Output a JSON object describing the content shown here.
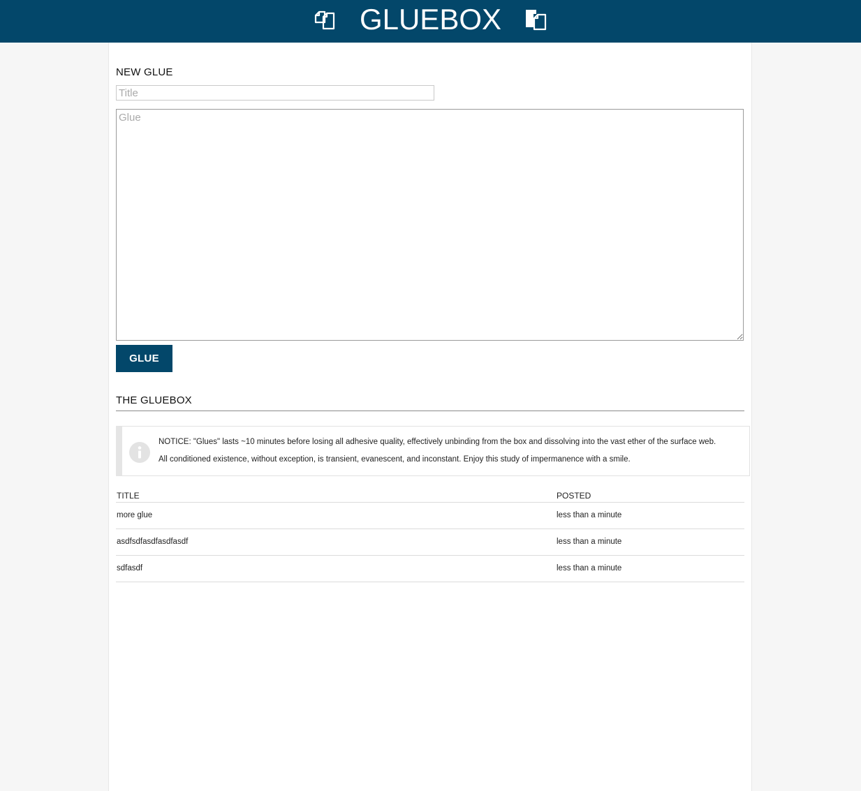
{
  "header": {
    "brand": "GLUEBOX",
    "left_icon": "copy-icon",
    "right_icon": "paste-icon"
  },
  "new_glue": {
    "heading": "NEW GLUE",
    "title_placeholder": "Title",
    "glue_placeholder": "Glue",
    "button_label": "GLUE"
  },
  "gluebox": {
    "heading": "THE GLUEBOX",
    "notice_icon": "info-icon",
    "notice_line1": "NOTICE: \"Glues\" lasts ~10 minutes before losing all adhesive quality, effectively unbinding from the box and dissolving into the vast ether of the surface web.",
    "notice_line2": "All conditioned existence, without exception, is transient, evanescent, and inconstant. Enjoy this study of impermanence with a smile.",
    "columns": [
      "TITLE",
      "POSTED"
    ],
    "rows": [
      {
        "title": "more glue",
        "posted": "less than a minute"
      },
      {
        "title": "asdfsdfasdfasdfasdf",
        "posted": "less than a minute"
      },
      {
        "title": "sdfasdf",
        "posted": "less than a minute"
      }
    ]
  },
  "colors": {
    "brand": "#03476a",
    "background": "#f6f6f6"
  }
}
